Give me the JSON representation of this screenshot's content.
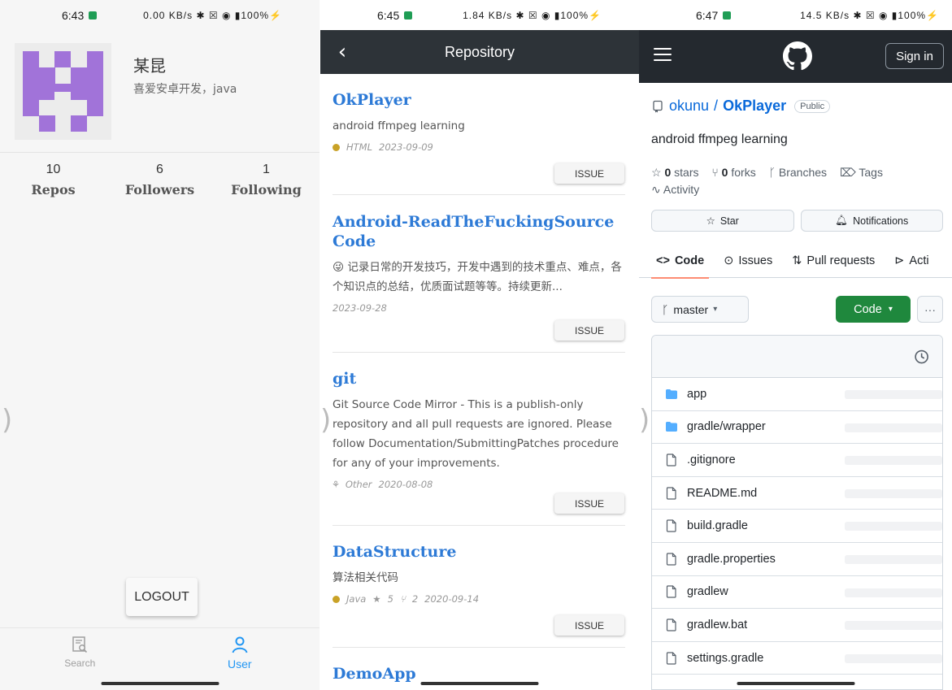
{
  "panel1": {
    "status": {
      "time": "6:43",
      "icons": "0.00 KB/s ✱ ☒ ◉ ▮100%⚡"
    },
    "profile": {
      "name": "某昆",
      "bio": "喜爱安卓开发，java"
    },
    "stats": [
      {
        "num": "10",
        "label": "Repos"
      },
      {
        "num": "6",
        "label": "Followers"
      },
      {
        "num": "1",
        "label": "Following"
      }
    ],
    "logout_label": "LOGOUT",
    "bottom_nav": [
      {
        "label": "Search",
        "icon": "search-doc-icon"
      },
      {
        "label": "User",
        "icon": "user-icon"
      }
    ],
    "colors": {
      "accent": "#2196f3",
      "avatar": "#a173d9"
    }
  },
  "panel2": {
    "status": {
      "time": "6:45",
      "icons": "1.84 KB/s ✱ ☒ ◉ ▮100%⚡"
    },
    "title": "Repository",
    "back_icon": "‹",
    "issue_label": "ISSUE",
    "repos": [
      {
        "name": "OkPlayer",
        "desc": "android ffmpeg learning",
        "lang": "HTML",
        "date": "2023-09-09"
      },
      {
        "name": "Android-ReadTheFuckingSourceCode",
        "desc": "😜 记录日常的开发技巧，开发中遇到的技术重点、难点，各个知识点的总结，优质面试题等等。持续更新...",
        "lang": "",
        "date": "2023-09-28"
      },
      {
        "name": "git",
        "desc": "Git Source Code Mirror - This is a publish-only repository and all pull requests are ignored. Please follow Documentation/SubmittingPatches procedure for any of your improvements.",
        "lang": "Other",
        "date": "2020-08-08"
      },
      {
        "name": "DataStructure",
        "desc": "算法相关代码",
        "lang": "Java",
        "stars": "5",
        "forks": "2",
        "date": "2020-09-14"
      },
      {
        "name": "DemoApp",
        "desc": "",
        "lang": "",
        "date": ""
      }
    ],
    "colors": {
      "appbar": "#2d3338",
      "link": "#2d7ad6"
    }
  },
  "panel3": {
    "status": {
      "time": "6:47",
      "icons": "14.5 KB/s ✱ ☒ ◉ ▮100%⚡"
    },
    "signin_label": "Sign in",
    "owner": "okunu",
    "slash": "/",
    "repo": "OkPlayer",
    "visibility": "Public",
    "description": "android ffmpeg learning",
    "stats": {
      "stars_num": "0",
      "stars_label": "stars",
      "forks_num": "0",
      "forks_label": "forks",
      "branches": "Branches",
      "tags": "Tags",
      "activity": "Activity"
    },
    "buttons": {
      "star": "Star",
      "notifications": "Notifications"
    },
    "tabs": [
      "Code",
      "Issues",
      "Pull requests",
      "Acti"
    ],
    "branch": "master",
    "code_button": "Code",
    "more_button": "···",
    "files": [
      {
        "name": "app",
        "type": "folder"
      },
      {
        "name": "gradle/wrapper",
        "type": "folder"
      },
      {
        "name": ".gitignore",
        "type": "file"
      },
      {
        "name": "README.md",
        "type": "file"
      },
      {
        "name": "build.gradle",
        "type": "file"
      },
      {
        "name": "gradle.properties",
        "type": "file"
      },
      {
        "name": "gradlew",
        "type": "file"
      },
      {
        "name": "gradlew.bat",
        "type": "file"
      },
      {
        "name": "settings.gradle",
        "type": "file"
      }
    ],
    "colors": {
      "header": "#24292f",
      "link": "#0969da",
      "green": "#1f883d",
      "folder": "#54aeff"
    }
  }
}
